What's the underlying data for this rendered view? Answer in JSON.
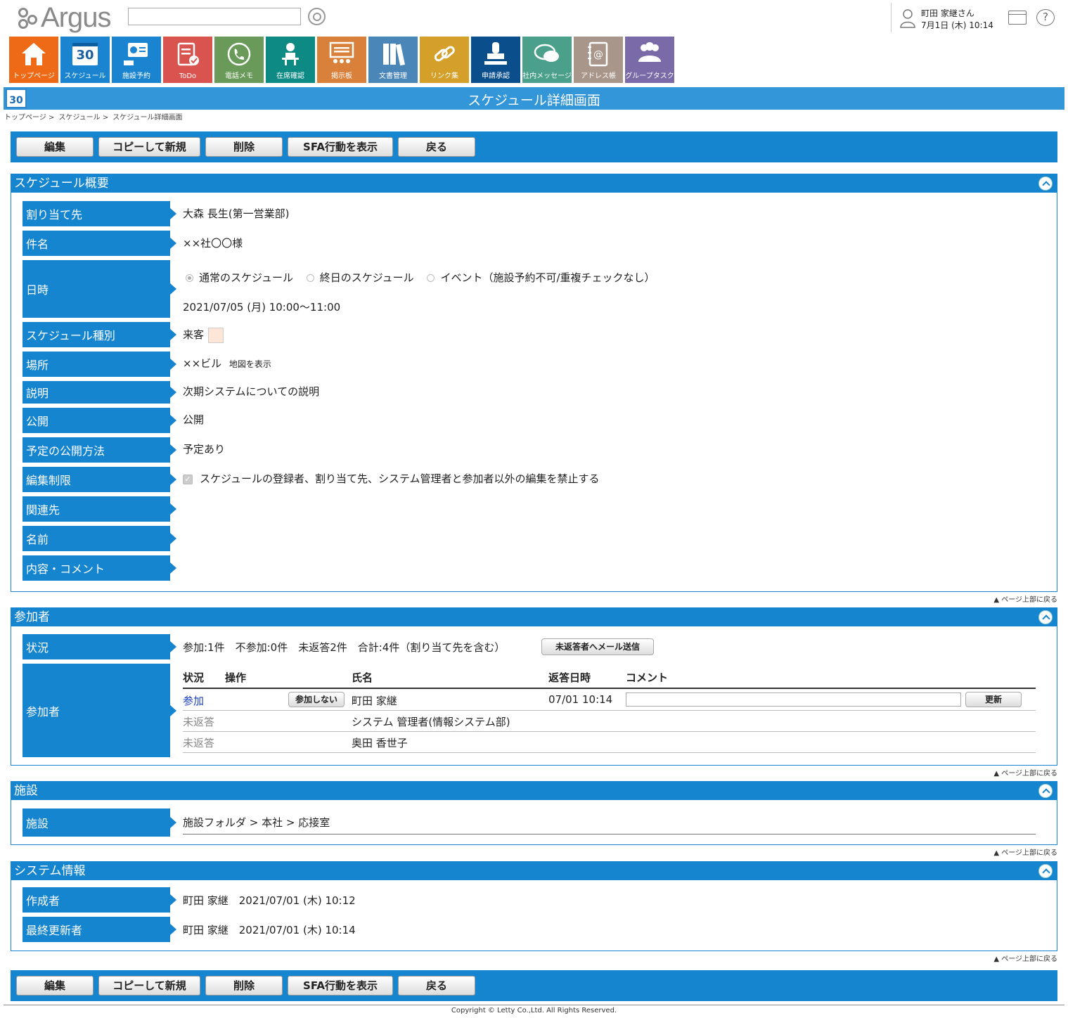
{
  "header": {
    "logo_text": "Argus",
    "search_placeholder": "",
    "user_name": "町田 家継さん",
    "user_date": "7月1日 (木) 10:14",
    "help": "?"
  },
  "nav": [
    {
      "label": "トップページ",
      "color": "#ee6a17",
      "icon": "home-icon"
    },
    {
      "label": "スケジュール",
      "color": "#1a84d0",
      "icon": "calendar-icon",
      "num": "30"
    },
    {
      "label": "施設予約",
      "color": "#1a84d0",
      "icon": "facility-icon"
    },
    {
      "label": "ToDo",
      "color": "#d9534f",
      "icon": "todo-icon"
    },
    {
      "label": "電話メモ",
      "color": "#6a9a5a",
      "icon": "phone-icon"
    },
    {
      "label": "在席確認",
      "color": "#0e8a84",
      "icon": "presence-icon"
    },
    {
      "label": "掲示板",
      "color": "#d9803a",
      "icon": "board-icon"
    },
    {
      "label": "文書管理",
      "color": "#4a86b8",
      "icon": "document-icon"
    },
    {
      "label": "リンク集",
      "color": "#d4a02a",
      "icon": "link-icon"
    },
    {
      "label": "申請承認",
      "color": "#0a4f8c",
      "icon": "stamp-icon"
    },
    {
      "label": "社内メッセージ",
      "color": "#4aa08a",
      "icon": "message-icon"
    },
    {
      "label": "アドレス帳",
      "color": "#a8968a",
      "icon": "address-icon"
    },
    {
      "label": "グループタスク",
      "color": "#7a6aa8",
      "icon": "group-icon"
    }
  ],
  "title": {
    "text": "スケジュール詳細画面",
    "cal": "30"
  },
  "breadcrumb": [
    "トップページ >",
    "スケジュール >",
    "スケジュール詳細画面"
  ],
  "toolbar": {
    "edit": "編集",
    "copy": "コピーして新規",
    "delete": "削除",
    "sfa": "SFA行動を表示",
    "back": "戻る"
  },
  "back_top": "▲ ページ上部に戻る",
  "overview": {
    "title": "スケジュール概要",
    "assignee_label": "割り当て先",
    "assignee": "大森 長生(第一営業部)",
    "subject_label": "件名",
    "subject": "××社〇〇様",
    "datetime_label": "日時",
    "radio_normal": "通常のスケジュール",
    "radio_allday": "終日のスケジュール",
    "radio_event": "イベント（施設予約不可/重複チェックなし）",
    "datetime": "2021/07/05 (月) 10:00～11:00",
    "type_label": "スケジュール種別",
    "type": "来客",
    "place_label": "場所",
    "place": "××ビル",
    "map_link": "地図を表示",
    "desc_label": "説明",
    "desc": "次期システムについての説明",
    "public_label": "公開",
    "public": "公開",
    "public_method_label": "予定の公開方法",
    "public_method": "予定あり",
    "edit_limit_label": "編集制限",
    "edit_limit": "スケジュールの登録者、割り当て先、システム管理者と参加者以外の編集を禁止する",
    "related_label": "関連先",
    "name_label": "名前",
    "comment_label": "内容・コメント"
  },
  "participants": {
    "title": "参加者",
    "status_label": "状況",
    "status": "参加:1件　不参加:0件　未返答2件　合計:4件（割り当て先を含む）",
    "mail_btn": "未返答者へメール送信",
    "list_label": "参加者",
    "headers": {
      "status": "状況",
      "op": "操作",
      "name": "氏名",
      "date": "返答日時",
      "comment": "コメント"
    },
    "rows": [
      {
        "status": "参加",
        "op": "参加しない",
        "name": "町田 家継",
        "date": "07/01 10:14",
        "update": "更新"
      },
      {
        "status": "未返答",
        "name": "システム 管理者(情報システム部)"
      },
      {
        "status": "未返答",
        "name": "奥田 香世子"
      }
    ]
  },
  "facility": {
    "title": "施設",
    "label": "施設",
    "value": "施設フォルダ > 本社 > 応接室"
  },
  "sysinfo": {
    "title": "システム情報",
    "creator_label": "作成者",
    "creator": "町田 家継　2021/07/01 (木) 10:12",
    "updater_label": "最終更新者",
    "updater": "町田 家継　2021/07/01 (木) 10:14"
  },
  "footer": "Copyright © Letty Co.,Ltd. All Rights Reserved."
}
